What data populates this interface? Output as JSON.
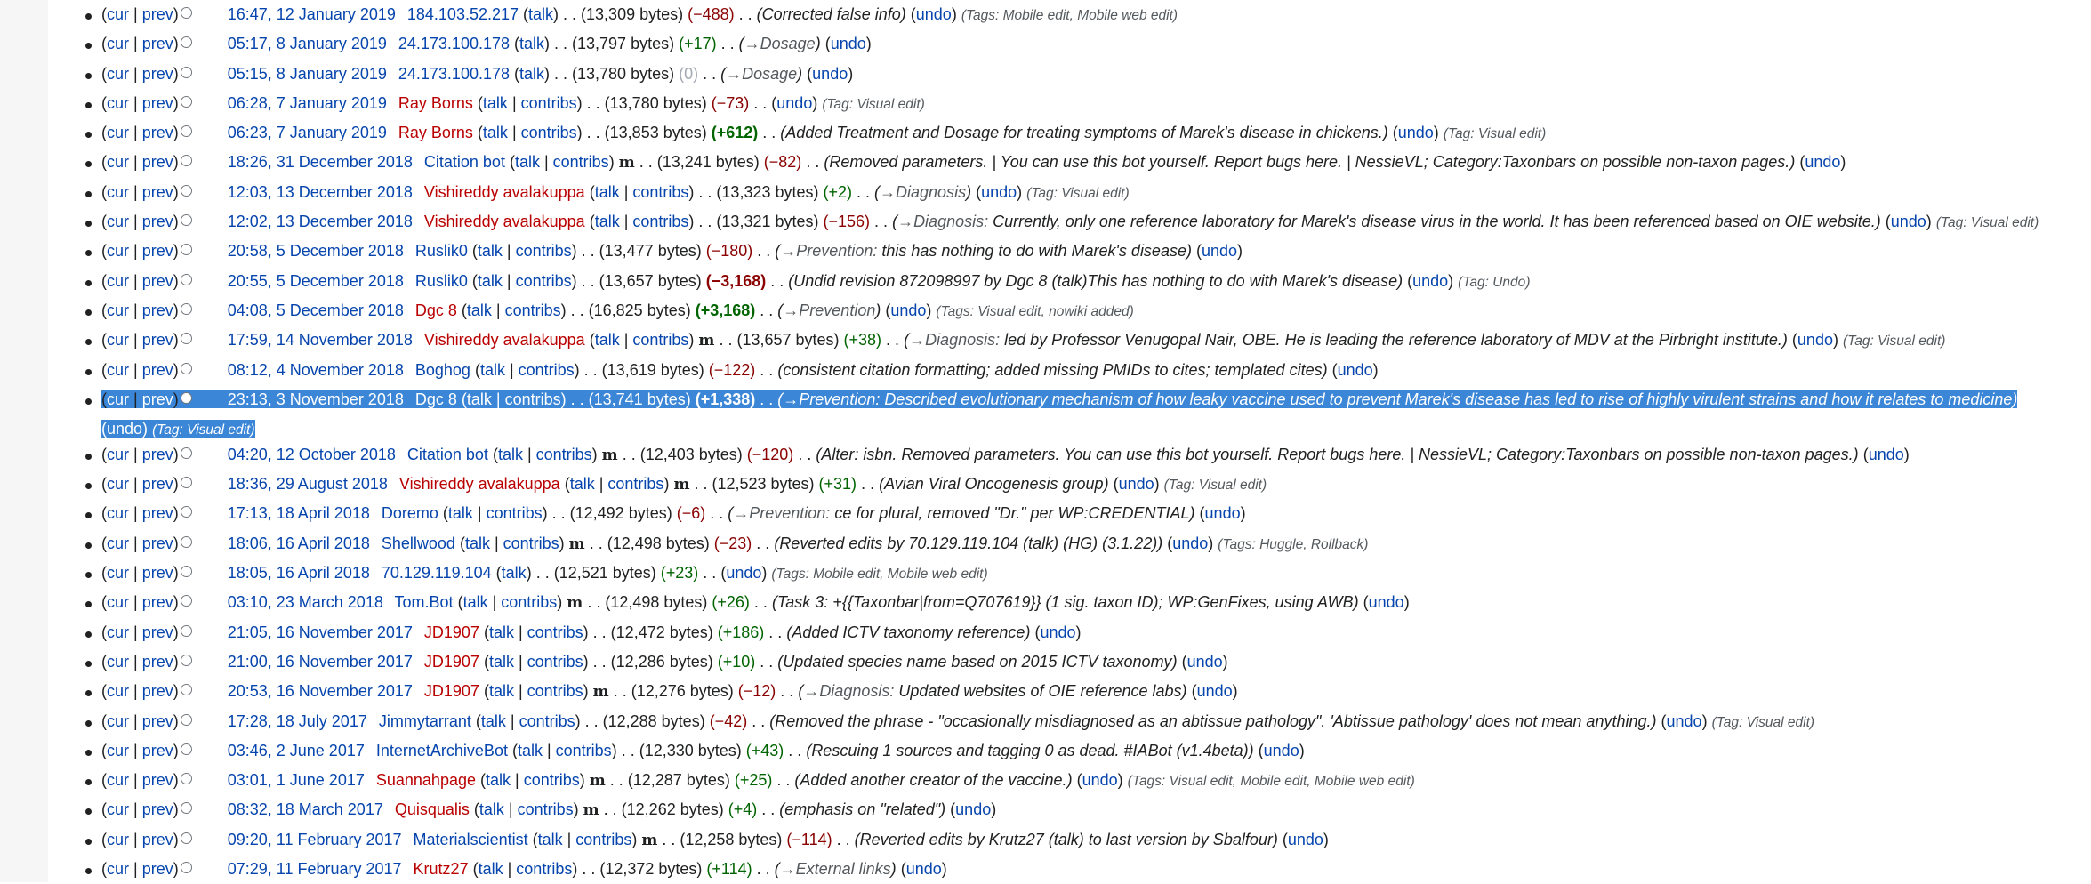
{
  "history": {
    "rows": [
      {
        "date": "16:47, 12 January 2019",
        "user": "184.103.52.217",
        "user_red": false,
        "ip": true,
        "minor": false,
        "bytes": "13,309 bytes",
        "change": "−488",
        "change_class": "neg",
        "summary": "Corrected false info",
        "summary_link": "",
        "summary_after": "",
        "tags": "Tags: Mobile edit, Mobile web edit"
      },
      {
        "date": "05:17, 8 January 2019",
        "user": "24.173.100.178",
        "user_red": false,
        "ip": true,
        "minor": false,
        "bytes": "13,797 bytes",
        "change": "+17",
        "change_class": "pos",
        "summary": "",
        "summary_link": "→Dosage",
        "summary_after": "",
        "tags": ""
      },
      {
        "date": "05:15, 8 January 2019",
        "user": "24.173.100.178",
        "user_red": false,
        "ip": true,
        "minor": false,
        "bytes": "13,780 bytes",
        "change": "0",
        "change_class": "zero",
        "summary": "",
        "summary_link": "→Dosage",
        "summary_after": "",
        "tags": ""
      },
      {
        "date": "06:28, 7 January 2019",
        "user": "Ray Borns",
        "user_red": true,
        "ip": false,
        "minor": false,
        "bytes": "13,780 bytes",
        "change": "−73",
        "change_class": "neg",
        "summary": "",
        "summary_link": "",
        "summary_after": "",
        "tags": "Tag: Visual edit"
      },
      {
        "date": "06:23, 7 January 2019",
        "user": "Ray Borns",
        "user_red": true,
        "ip": false,
        "minor": false,
        "bytes": "13,853 bytes",
        "change": "+612",
        "change_class": "bigpos",
        "summary": "Added Treatment and Dosage for treating symptoms of Marek's disease in chickens.",
        "summary_link": "",
        "summary_after": "",
        "tags": "Tag: Visual edit"
      },
      {
        "date": "18:26, 31 December 2018",
        "user": "Citation bot",
        "user_red": false,
        "ip": false,
        "minor": true,
        "bytes": "13,241 bytes",
        "change": "−82",
        "change_class": "neg",
        "summary": "Removed parameters. | You can use this bot yourself. Report bugs here. | NessieVL; Category:Taxonbars on possible non-taxon pages.",
        "summary_link": "",
        "summary_after": "",
        "tags": ""
      },
      {
        "date": "12:03, 13 December 2018",
        "user": "Vishireddy avalakuppa",
        "user_red": true,
        "ip": false,
        "minor": false,
        "bytes": "13,323 bytes",
        "change": "+2",
        "change_class": "pos",
        "summary": "",
        "summary_link": "→Diagnosis",
        "summary_after": "",
        "tags": "Tag: Visual edit"
      },
      {
        "date": "12:02, 13 December 2018",
        "user": "Vishireddy avalakuppa",
        "user_red": true,
        "ip": false,
        "minor": false,
        "bytes": "13,321 bytes",
        "change": "−156",
        "change_class": "neg",
        "summary": "",
        "summary_link": "→Diagnosis:",
        "summary_after": " Currently, only one reference laboratory for Marek's disease virus in the world. It has been referenced based on OIE website.",
        "tags": "Tag: Visual edit"
      },
      {
        "date": "20:58, 5 December 2018",
        "user": "Ruslik0",
        "user_red": false,
        "ip": false,
        "minor": false,
        "bytes": "13,477 bytes",
        "change": "−180",
        "change_class": "neg",
        "summary": "",
        "summary_link": "→Prevention:",
        "summary_after": " this has nothing to do with Marek's disease",
        "tags": ""
      },
      {
        "date": "20:55, 5 December 2018",
        "user": "Ruslik0",
        "user_red": false,
        "ip": false,
        "minor": false,
        "bytes": "13,657 bytes",
        "change": "−3,168",
        "change_class": "bigneg",
        "summary": "Undid revision 872098997 by Dgc 8 (talk)This has nothing to do with Marek's disease",
        "summary_link": "",
        "summary_after": "",
        "tags": "Tag: Undo"
      },
      {
        "date": "04:08, 5 December 2018",
        "user": "Dgc 8",
        "user_red": true,
        "ip": false,
        "minor": false,
        "bytes": "16,825 bytes",
        "change": "+3,168",
        "change_class": "bigpos",
        "summary": "",
        "summary_link": "→Prevention",
        "summary_after": "",
        "tags": "Tags: Visual edit, nowiki added"
      },
      {
        "date": "17:59, 14 November 2018",
        "user": "Vishireddy avalakuppa",
        "user_red": true,
        "ip": false,
        "minor": true,
        "bytes": "13,657 bytes",
        "change": "+38",
        "change_class": "pos",
        "summary": "",
        "summary_link": "→Diagnosis:",
        "summary_after": " led by Professor Venugopal Nair, OBE. He is leading the reference laboratory of MDV at the Pirbright institute.",
        "tags": "Tag: Visual edit"
      },
      {
        "date": "08:12, 4 November 2018",
        "user": "Boghog",
        "user_red": false,
        "ip": false,
        "minor": false,
        "bytes": "13,619 bytes",
        "change": "−122",
        "change_class": "neg",
        "summary": "consistent citation formatting; added missing PMIDs to cites; templated cites",
        "summary_link": "",
        "summary_after": "",
        "tags": ""
      },
      {
        "date": "23:13, 3 November 2018",
        "user": "Dgc 8",
        "user_red": true,
        "ip": false,
        "minor": false,
        "bytes": "13,741 bytes",
        "change": "+1,338",
        "change_class": "bigpos",
        "summary": "",
        "summary_link": "→Prevention:",
        "summary_after": " Described evolutionary mechanism of how leaky vaccine used to prevent Marek's disease has led to rise of highly virulent strains and how it relates to medicine",
        "tags": "Tag: Visual edit",
        "selected": true
      },
      {
        "date": "04:20, 12 October 2018",
        "user": "Citation bot",
        "user_red": false,
        "ip": false,
        "minor": true,
        "bytes": "12,403 bytes",
        "change": "−120",
        "change_class": "neg",
        "summary": "Alter: isbn. Removed parameters. You can use this bot yourself. Report bugs here. | NessieVL; Category:Taxonbars on possible non-taxon pages.",
        "summary_link": "",
        "summary_after": "",
        "tags": ""
      },
      {
        "date": "18:36, 29 August 2018",
        "user": "Vishireddy avalakuppa",
        "user_red": true,
        "ip": false,
        "minor": true,
        "bytes": "12,523 bytes",
        "change": "+31",
        "change_class": "pos",
        "summary": "Avian Viral Oncogenesis group",
        "summary_link": "",
        "summary_after": "",
        "tags": "Tag: Visual edit"
      },
      {
        "date": "17:13, 18 April 2018",
        "user": "Doremo",
        "user_red": false,
        "ip": false,
        "minor": false,
        "bytes": "12,492 bytes",
        "change": "−6",
        "change_class": "neg",
        "summary": "",
        "summary_link": "→Prevention:",
        "summary_after": " ce for plural, removed \"Dr.\" per WP:CREDENTIAL",
        "tags": ""
      },
      {
        "date": "18:06, 16 April 2018",
        "user": "Shellwood",
        "user_red": false,
        "ip": false,
        "minor": true,
        "bytes": "12,498 bytes",
        "change": "−23",
        "change_class": "neg",
        "summary": "Reverted edits by 70.129.119.104 (talk) (HG) (3.1.22)",
        "summary_link": "",
        "summary_after": "",
        "tags": "Tags: Huggle, Rollback"
      },
      {
        "date": "18:05, 16 April 2018",
        "user": "70.129.119.104",
        "user_red": false,
        "ip": true,
        "minor": false,
        "bytes": "12,521 bytes",
        "change": "+23",
        "change_class": "pos",
        "summary": "",
        "summary_link": "",
        "summary_after": "",
        "tags": "Tags: Mobile edit, Mobile web edit"
      },
      {
        "date": "03:10, 23 March 2018",
        "user": "Tom.Bot",
        "user_red": false,
        "ip": false,
        "minor": true,
        "bytes": "12,498 bytes",
        "change": "+26",
        "change_class": "pos",
        "summary": "Task 3: +{{Taxonbar|from=Q707619}} (1 sig. taxon ID); WP:GenFixes, using AWB",
        "summary_link": "",
        "summary_after": "",
        "tags": ""
      },
      {
        "date": "21:05, 16 November 2017",
        "user": "JD1907",
        "user_red": true,
        "ip": false,
        "minor": false,
        "bytes": "12,472 bytes",
        "change": "+186",
        "change_class": "pos",
        "summary": "Added ICTV taxonomy reference",
        "summary_link": "",
        "summary_after": "",
        "tags": ""
      },
      {
        "date": "21:00, 16 November 2017",
        "user": "JD1907",
        "user_red": true,
        "ip": false,
        "minor": false,
        "bytes": "12,286 bytes",
        "change": "+10",
        "change_class": "pos",
        "summary": "Updated species name based on 2015 ICTV taxonomy",
        "summary_link": "",
        "summary_after": "",
        "tags": ""
      },
      {
        "date": "20:53, 16 November 2017",
        "user": "JD1907",
        "user_red": true,
        "ip": false,
        "minor": true,
        "bytes": "12,276 bytes",
        "change": "−12",
        "change_class": "neg",
        "summary": "",
        "summary_link": "→Diagnosis:",
        "summary_after": " Updated websites of OIE reference labs",
        "tags": ""
      },
      {
        "date": "17:28, 18 July 2017",
        "user": "Jimmytarrant",
        "user_red": false,
        "ip": false,
        "minor": false,
        "bytes": "12,288 bytes",
        "change": "−42",
        "change_class": "neg",
        "summary": "Removed the phrase - \"occasionally misdiagnosed as an abtissue pathology\". 'Abtissue pathology' does not mean anything.",
        "summary_link": "",
        "summary_after": "",
        "tags": "Tag: Visual edit"
      },
      {
        "date": "03:46, 2 June 2017",
        "user": "InternetArchiveBot",
        "user_red": false,
        "ip": false,
        "minor": false,
        "bytes": "12,330 bytes",
        "change": "+43",
        "change_class": "pos",
        "summary": "Rescuing 1 sources and tagging 0 as dead. #IABot (v1.4beta)",
        "summary_link": "",
        "summary_after": "",
        "tags": ""
      },
      {
        "date": "03:01, 1 June 2017",
        "user": "Suannahpage",
        "user_red": true,
        "ip": false,
        "minor": true,
        "bytes": "12,287 bytes",
        "change": "+25",
        "change_class": "pos",
        "summary": "Added another creator of the vaccine.",
        "summary_link": "",
        "summary_after": "",
        "tags": "Tags: Visual edit, Mobile edit, Mobile web edit"
      },
      {
        "date": "08:32, 18 March 2017",
        "user": "Quisqualis",
        "user_red": true,
        "ip": false,
        "minor": true,
        "bytes": "12,262 bytes",
        "change": "+4",
        "change_class": "pos",
        "summary": "emphasis on \"related\"",
        "summary_link": "",
        "summary_after": "",
        "tags": ""
      },
      {
        "date": "09:20, 11 February 2017",
        "user": "Materialscientist",
        "user_red": false,
        "ip": false,
        "minor": true,
        "bytes": "12,258 bytes",
        "change": "−114",
        "change_class": "neg",
        "summary": "Reverted edits by Krutz27 (talk) to last version by Sbalfour",
        "summary_link": "",
        "summary_after": "",
        "tags": ""
      },
      {
        "date": "07:29, 11 February 2017",
        "user": "Krutz27",
        "user_red": true,
        "ip": false,
        "minor": false,
        "bytes": "12,372 bytes",
        "change": "+114",
        "change_class": "pos",
        "summary": "",
        "summary_link": "→External links",
        "summary_after": "",
        "tags": ""
      }
    ],
    "labels": {
      "cur": "cur",
      "prev": "prev",
      "talk": "talk",
      "contribs": "contribs",
      "undo": "undo",
      "minor": "m",
      "dots": ". ."
    }
  }
}
